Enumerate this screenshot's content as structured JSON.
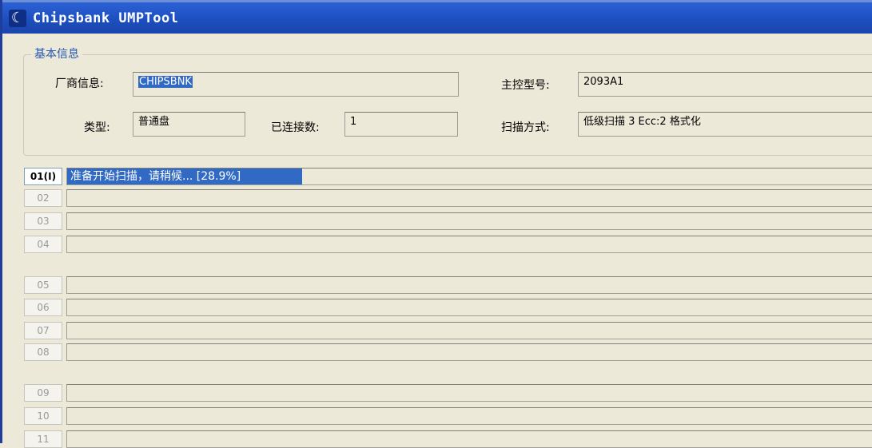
{
  "window": {
    "title": "Chipsbank UMPTool",
    "icon": "app-logo-icon"
  },
  "basic_info": {
    "legend": "基本信息",
    "vendor_label": "厂商信息:",
    "vendor_value": "CHIPSBNK",
    "controller_label": "主控型号:",
    "controller_value": "2093A1",
    "type_label": "类型:",
    "type_value": "普通盘",
    "connected_label": "已连接数:",
    "connected_value": "1",
    "scan_label": "扫描方式:",
    "scan_value": "低级扫描 3 Ecc:2 格式化"
  },
  "slots": [
    {
      "num": "01(I)",
      "status": "准备开始扫描，请稍候... [28.9%]",
      "progress": 0.289,
      "active": true
    },
    {
      "num": "02",
      "status": "",
      "progress": 0,
      "active": false
    },
    {
      "num": "03",
      "status": "",
      "progress": 0,
      "active": false
    },
    {
      "num": "04",
      "status": "",
      "progress": 0,
      "active": false
    },
    {
      "num": "05",
      "status": "",
      "progress": 0,
      "active": false
    },
    {
      "num": "06",
      "status": "",
      "progress": 0,
      "active": false
    },
    {
      "num": "07",
      "status": "",
      "progress": 0,
      "active": false
    },
    {
      "num": "08",
      "status": "",
      "progress": 0,
      "active": false
    },
    {
      "num": "09",
      "status": "",
      "progress": 0,
      "active": false
    },
    {
      "num": "10",
      "status": "",
      "progress": 0,
      "active": false
    },
    {
      "num": "11",
      "status": "",
      "progress": 0,
      "active": false
    }
  ],
  "colors": {
    "titlebar": "#1d4fc0",
    "progress_fill": "#316ac5",
    "legend_text": "#2356b8"
  }
}
